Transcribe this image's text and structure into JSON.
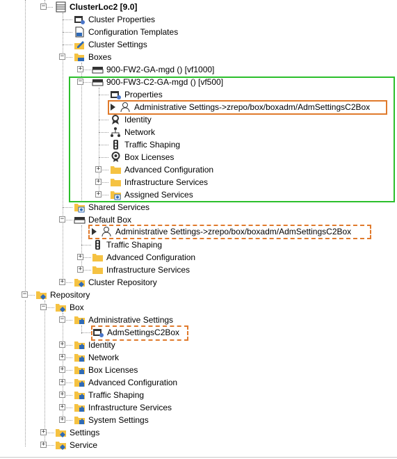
{
  "tree": {
    "cluster": "ClusterLoc2 [9.0]",
    "cluster_properties": "Cluster Properties",
    "configuration_templates": "Configuration Templates",
    "cluster_settings": "Cluster Settings",
    "boxes": "Boxes",
    "box1": "900-FW2-GA-mgd () [vf1000]",
    "box2": "900-FW3-C2-GA-mgd () [vf500]",
    "properties": "Properties",
    "admin_link_1": "Administrative Settings->zrepo/box/boxadm/AdmSettingsC2Box",
    "identity": "Identity",
    "network": "Network",
    "traffic_shaping": "Traffic Shaping",
    "box_licenses": "Box Licenses",
    "advanced_configuration": "Advanced Configuration",
    "infrastructure_services": "Infrastructure Services",
    "assigned_services": "Assigned Services",
    "shared_services": "Shared Services",
    "default_box": "Default Box",
    "admin_link_2": "Administrative Settings->zrepo/box/boxadm/AdmSettingsC2Box",
    "traffic_shaping_2": "Traffic Shaping",
    "advanced_configuration_2": "Advanced Configuration",
    "infrastructure_services_2": "Infrastructure Services",
    "cluster_repository": "Cluster Repository",
    "repository": "Repository",
    "repo_box": "Box",
    "repo_admin_settings": "Administrative Settings",
    "repo_adm_c2box": "AdmSettingsC2Box",
    "repo_identity": "Identity",
    "repo_network": "Network",
    "repo_box_licenses": "Box Licenses",
    "repo_advanced_configuration": "Advanced Configuration",
    "repo_traffic_shaping": "Traffic Shaping",
    "repo_infrastructure_services": "Infrastructure Services",
    "repo_system_settings": "System Settings",
    "settings": "Settings",
    "service": "Service"
  },
  "colors": {
    "green_highlight": "#2bbf2b",
    "orange_highlight": "#e07a2c",
    "folder": "#f5c242"
  }
}
